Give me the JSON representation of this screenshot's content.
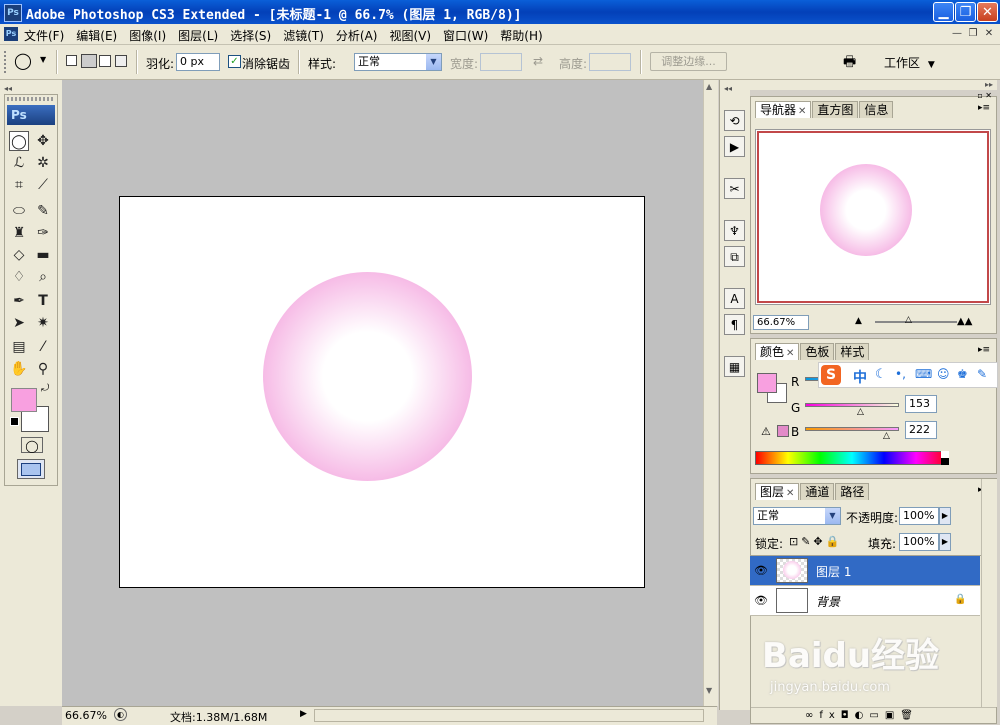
{
  "window": {
    "title": "Adobe Photoshop CS3 Extended - [未标题-1 @ 66.7% (图层 1, RGB/8)]",
    "app_icon": "Ps"
  },
  "menu": {
    "items": [
      "文件(F)",
      "编辑(E)",
      "图像(I)",
      "图层(L)",
      "选择(S)",
      "滤镜(T)",
      "分析(A)",
      "视图(V)",
      "窗口(W)",
      "帮助(H)"
    ]
  },
  "options": {
    "feather_label": "羽化:",
    "feather_value": "0 px",
    "antialias_label": "消除锯齿",
    "antialias_checked": true,
    "style_label": "样式:",
    "style_value": "正常",
    "width_label": "宽度:",
    "height_label": "高度:",
    "refine_edge_label": "调整边缘...",
    "workspace_label": "工作区"
  },
  "toolbox": {
    "logo": "Ps",
    "foreground_color": "#f8a0e0",
    "background_color": "#ffffff"
  },
  "canvas": {
    "circle_edge_color": "#f08ad4",
    "circle_center_color": "#ffffff"
  },
  "status": {
    "zoom": "66.67%",
    "doc_info": "文档:1.38M/1.68M"
  },
  "navigator": {
    "tabs": [
      "导航器",
      "直方图",
      "信息"
    ],
    "zoom": "66.67%"
  },
  "color_panel": {
    "tabs": [
      "颜色",
      "色板",
      "样式"
    ],
    "channels": [
      {
        "label": "R",
        "value": ""
      },
      {
        "label": "G",
        "value": "153"
      },
      {
        "label": "B",
        "value": "222"
      }
    ],
    "foreground": "#f8a0e0"
  },
  "ime": {
    "label": "中"
  },
  "layers_panel": {
    "tabs": [
      "图层",
      "通道",
      "路径"
    ],
    "blend_mode": "正常",
    "opacity_label": "不透明度:",
    "opacity_value": "100%",
    "lock_label": "锁定:",
    "fill_label": "填充:",
    "fill_value": "100%",
    "layers": [
      {
        "name": "图层 1",
        "selected": true
      },
      {
        "name": "背景",
        "selected": false
      }
    ]
  },
  "watermark": {
    "brand": "Baidu经验",
    "url": "jingyan.baidu.com"
  }
}
